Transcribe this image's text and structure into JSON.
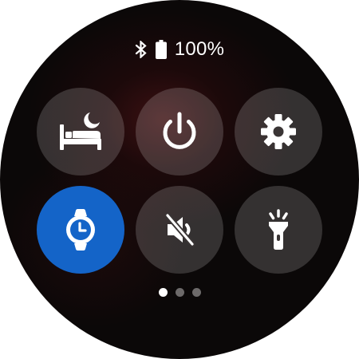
{
  "status_bar": {
    "bluetooth_icon": "bluetooth-icon",
    "battery_icon": "battery-icon",
    "battery_percent": "100%"
  },
  "tiles": [
    {
      "id": "bedtime-mode",
      "icon": "bed-moon-icon",
      "active": false
    },
    {
      "id": "power",
      "icon": "power-icon",
      "active": false
    },
    {
      "id": "settings",
      "icon": "gear-icon",
      "active": false
    },
    {
      "id": "watch-only",
      "icon": "watch-icon",
      "active": true
    },
    {
      "id": "sound-mute",
      "icon": "speaker-muted-icon",
      "active": false
    },
    {
      "id": "flashlight",
      "icon": "flashlight-icon",
      "active": false
    }
  ],
  "pager": {
    "total_pages": 3,
    "current_page": 1
  },
  "colors": {
    "active_tile": "#1464c8",
    "tile_background": "rgba(255,255,255,0.17)",
    "icon": "#ffffff",
    "screen_background": "#0b0808"
  }
}
